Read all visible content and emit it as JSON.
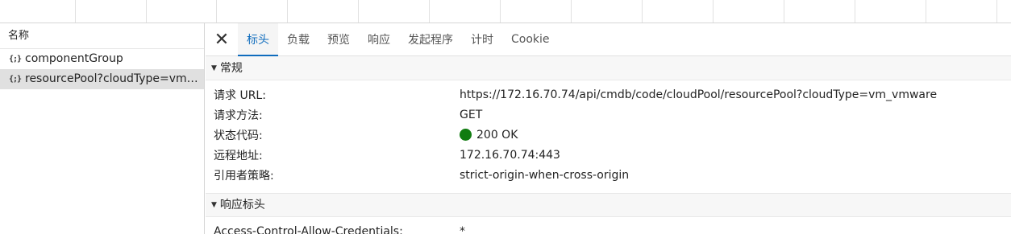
{
  "request_list": {
    "header": "名称",
    "items": [
      {
        "icon": "json-icon",
        "glyph": "{;}",
        "name": "componentGroup",
        "selected": false
      },
      {
        "icon": "json-icon",
        "glyph": "{;}",
        "name": "resourcePool?cloudType=vm_v...",
        "selected": true
      }
    ]
  },
  "tabs": [
    {
      "label": "标头",
      "active": true
    },
    {
      "label": "负载",
      "active": false
    },
    {
      "label": "预览",
      "active": false
    },
    {
      "label": "响应",
      "active": false
    },
    {
      "label": "发起程序",
      "active": false
    },
    {
      "label": "计时",
      "active": false
    },
    {
      "label": "Cookie",
      "active": false
    }
  ],
  "close_glyph": "✕",
  "general": {
    "title": "常规",
    "caret": "▼",
    "rows": [
      {
        "key": "请求 URL:",
        "value": "https://172.16.70.74/api/cmdb/code/cloudPool/resourcePool?cloudType=vm_vmware"
      },
      {
        "key": "请求方法:",
        "value": "GET"
      },
      {
        "key": "状态代码:",
        "value": "200 OK",
        "status_color": "#107c10"
      },
      {
        "key": "远程地址:",
        "value": "172.16.70.74:443"
      },
      {
        "key": "引用者策略:",
        "value": "strict-origin-when-cross-origin"
      }
    ]
  },
  "response_headers": {
    "title": "响应标头",
    "caret": "▼",
    "rows": [
      {
        "key": "Access-Control-Allow-Credentials:",
        "value": "*"
      }
    ]
  },
  "colors": {
    "accent": "#0f6cbd",
    "status_ok": "#107c10",
    "selected_bg": "#e0e0e0"
  }
}
